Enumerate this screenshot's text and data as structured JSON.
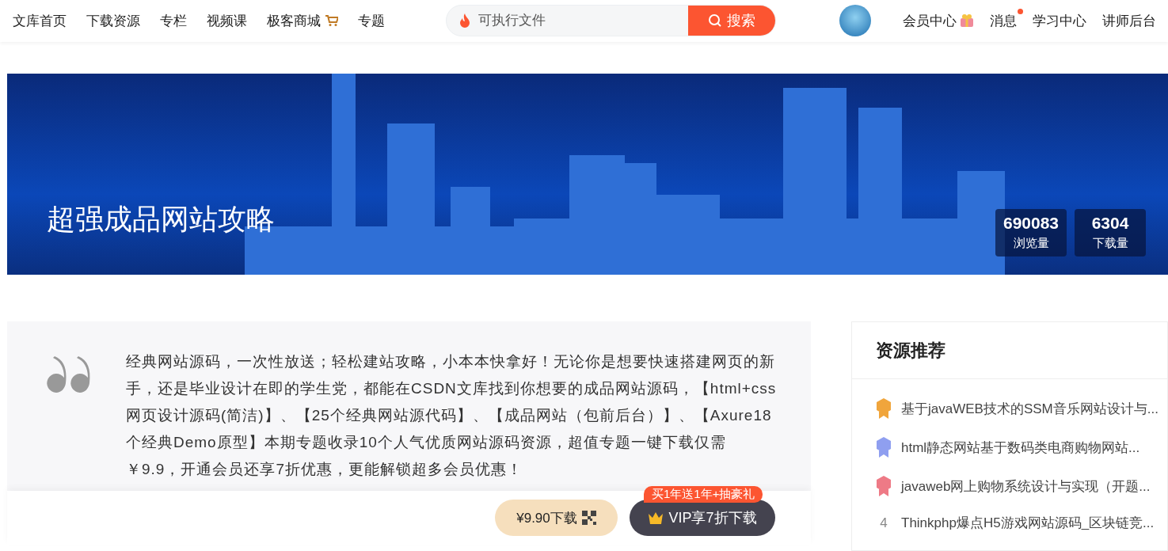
{
  "nav": [
    {
      "label": "文库首页",
      "kind": "plain"
    },
    {
      "label": "下载资源",
      "kind": "plain"
    },
    {
      "label": "专栏",
      "kind": "plain"
    },
    {
      "label": "视频课",
      "kind": "plain"
    },
    {
      "label": "极客商城",
      "kind": "shop"
    },
    {
      "label": "专题",
      "kind": "plain"
    }
  ],
  "search": {
    "placeholder": "可执行文件",
    "button": "搜索"
  },
  "user_links": [
    {
      "label": "会员中心",
      "kind": "gift",
      "badge": false
    },
    {
      "label": "消息",
      "kind": "plain",
      "badge": true
    },
    {
      "label": "学习中心",
      "kind": "plain",
      "badge": false
    },
    {
      "label": "讲师后台",
      "kind": "plain",
      "badge": false
    }
  ],
  "banner": {
    "title": "超强成品网站攻略",
    "stats": [
      {
        "value": "690083",
        "label": "浏览量"
      },
      {
        "value": "6304",
        "label": "下载量"
      }
    ]
  },
  "intro": {
    "text": "经典网站源码，一次性放送；轻松建站攻略，小本本快拿好！无论你是想要快速搭建网页的新手，还是毕业设计在即的学生党，都能在CSDN文库找到你想要的成品网站源码，【html+css网页设计源码(简洁)】、【25个经典网站源代码】、【成品网站（包前后台）】、【Axure18个经典Demo原型】本期专题收录10个人气优质网站源码资源，超值专题一键下载仅需￥9.9，开通会员还享7折优惠，更能解锁超多会员优惠！"
  },
  "actions": {
    "buy": "¥9.90下载",
    "vip": "VIP享7折下载",
    "promo": "买1年送1年+抽豪礼"
  },
  "recommend": {
    "title": "资源推荐",
    "items": [
      {
        "kind": "medal",
        "color": "#f0a53c",
        "title": "基于javaWEB技术的SSM音乐网站设计与..."
      },
      {
        "kind": "medal",
        "color": "#8f9ff0",
        "title": "html静态网站基于数码类电商购物网站..."
      },
      {
        "kind": "medal",
        "color": "#ee7a86",
        "title": "javaweb网上购物系统设计与实现（开题..."
      },
      {
        "kind": "number",
        "rank": "4",
        "title": "Thinkphp爆点H5游戏网站源码_区块链竞..."
      }
    ]
  }
}
